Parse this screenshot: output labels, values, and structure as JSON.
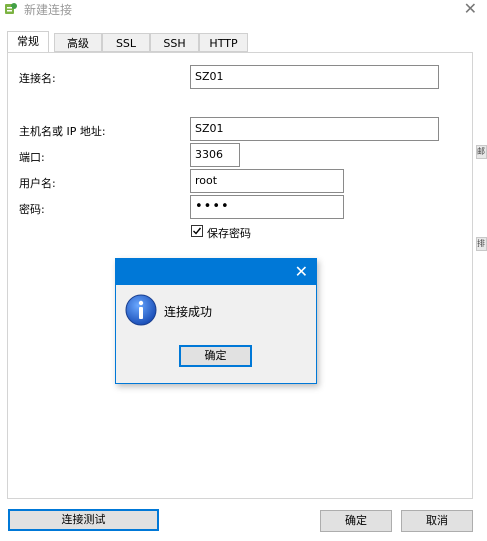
{
  "window": {
    "title": "新建连接",
    "close_glyph": "✕"
  },
  "tabs": [
    {
      "label": "常规",
      "active": true
    },
    {
      "label": "高级",
      "active": false
    },
    {
      "label": "SSL",
      "active": false
    },
    {
      "label": "SSH",
      "active": false
    },
    {
      "label": "HTTP",
      "active": false
    }
  ],
  "form": {
    "connection_name_label": "连接名:",
    "connection_name_value": "SZ01",
    "host_label": "主机名或 IP 地址:",
    "host_value": "SZ01",
    "port_label": "端口:",
    "port_value": "3306",
    "username_label": "用户名:",
    "username_value": "root",
    "password_label": "密码:",
    "password_value": "••••",
    "save_password_label": "保存密码",
    "save_password_checked": true
  },
  "buttons": {
    "test_connection": "连接测试",
    "ok": "确定",
    "cancel": "取消"
  },
  "right_edge": {
    "fragment_1": "邮",
    "fragment_2": "排"
  },
  "message_box": {
    "close_glyph": "✕",
    "message": "连接成功",
    "ok_label": "确定",
    "icon": "info-icon"
  },
  "colors": {
    "accent": "#0078d7",
    "dialog_bg": "#f0f0f0"
  }
}
